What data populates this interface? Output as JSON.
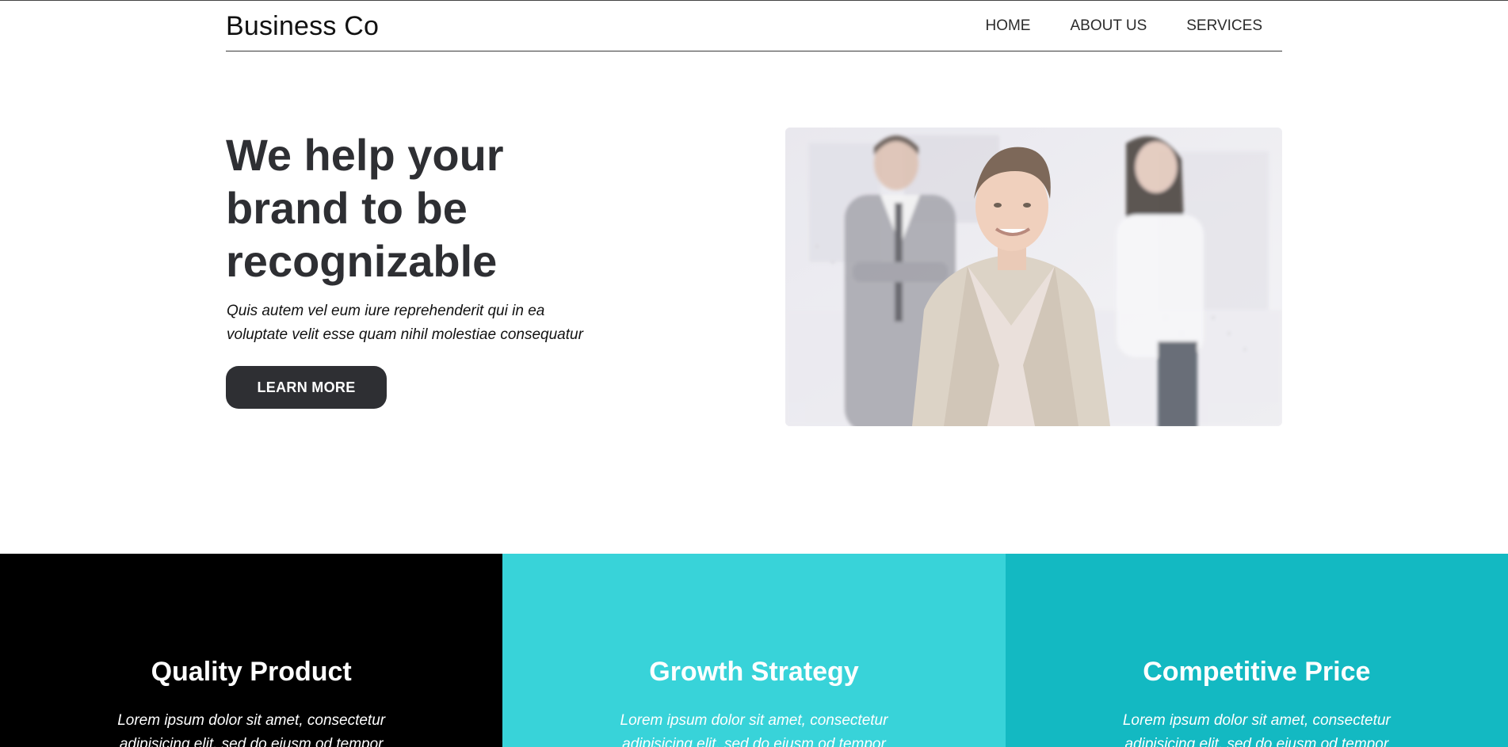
{
  "header": {
    "brand": "Business Co",
    "nav": [
      "HOME",
      "ABOUT US",
      "SERVICES"
    ]
  },
  "hero": {
    "title_lines": [
      "We help your",
      "brand to be",
      "recognizable"
    ],
    "subtitle_lines": [
      "Quis autem vel eum iure reprehenderit qui in ea",
      "voluptate velit esse quam nihil molestiae consequatur"
    ],
    "button_label": "LEARN MORE",
    "image_icon": "team-photo-icon"
  },
  "features": [
    {
      "title": "Quality Product",
      "text_lines": [
        "Lorem ipsum dolor sit amet, consectetur",
        "adipisicing elit, sed do eiusm od tempor"
      ],
      "color": "#000000"
    },
    {
      "title": "Growth Strategy",
      "text_lines": [
        "Lorem ipsum dolor sit amet, consectetur",
        "adipisicing elit, sed do eiusm od tempor"
      ],
      "color": "#38d3d9"
    },
    {
      "title": "Competitive Price",
      "text_lines": [
        "Lorem ipsum dolor sit amet, consectetur",
        "adipisicing elit, sed do eiusm od tempor"
      ],
      "color": "#13b9c2"
    }
  ]
}
